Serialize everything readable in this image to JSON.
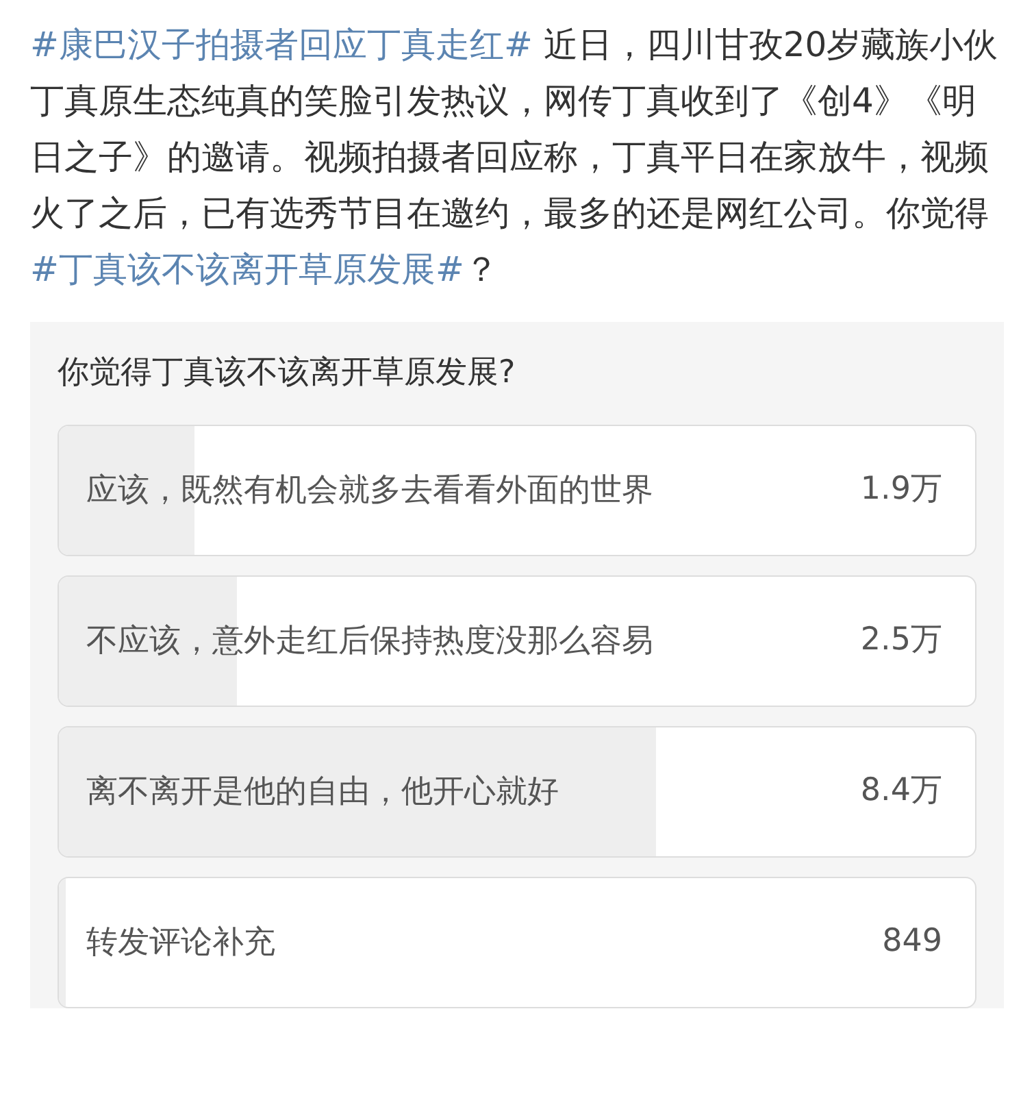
{
  "post": {
    "segments": [
      {
        "kind": "hashtag",
        "text": "#康巴汉子拍摄者回应丁真走红#"
      },
      {
        "kind": "text",
        "text": " 近日，四川甘孜20岁藏族小伙丁真原生态纯真的笑脸引发热议，网传丁真收到了《创4》《明日之子》的邀请。视频拍摄者回应称，丁真平日在家放牛，视频火了之后，已有选秀节目在邀约，最多的还是网红公司。你觉得"
      },
      {
        "kind": "hashtag",
        "text": "#丁真该不该离开草原发展#"
      },
      {
        "kind": "text",
        "text": "？"
      }
    ]
  },
  "poll": {
    "question": "你觉得丁真该不该离开草原发展?",
    "options": [
      {
        "label": "应该，既然有机会就多去看看外面的世界",
        "count": "1.9万",
        "level": 0.148
      },
      {
        "label": "不应该，意外走红后保持热度没那么容易",
        "count": "2.5万",
        "level": 0.194
      },
      {
        "label": "离不离开是他的自由，他开心就好",
        "count": "8.4万",
        "level": 0.652
      },
      {
        "label": "转发评论补充",
        "count": "849",
        "level": 0.007
      }
    ]
  }
}
